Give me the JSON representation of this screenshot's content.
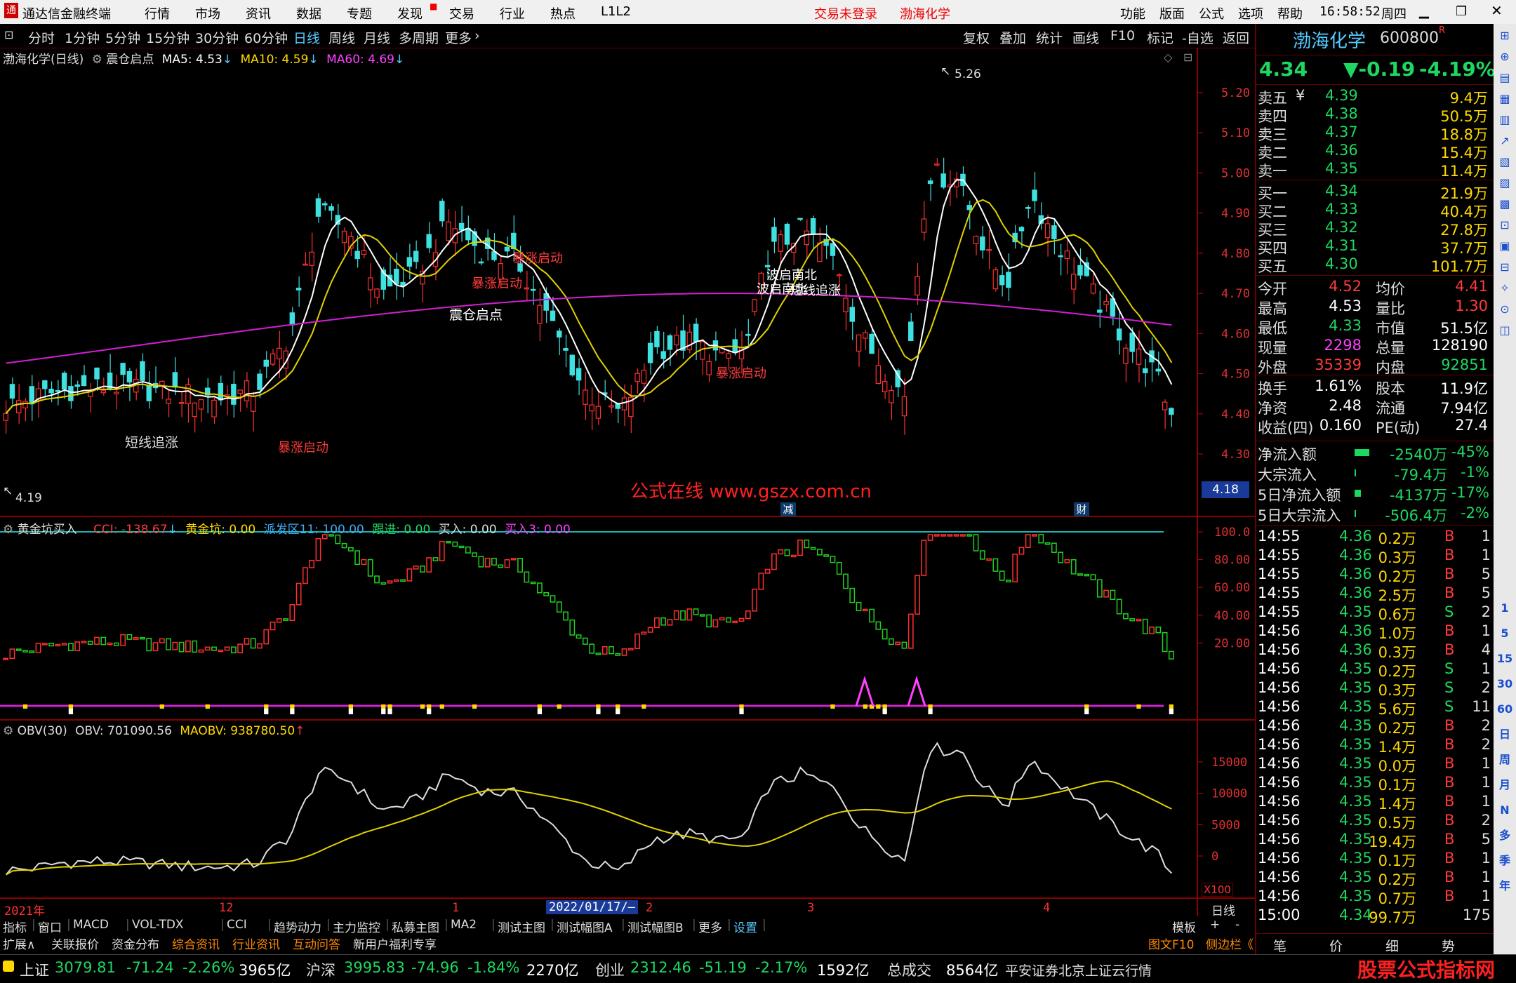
{
  "menubar": {
    "app_title": "通达信金融终端",
    "menus": [
      "行情",
      "市场",
      "资讯",
      "数据",
      "专题",
      "发现",
      "交易",
      "行业",
      "热点",
      "L1L2"
    ],
    "center_status": "交易未登录",
    "center_stock": "渤海化学",
    "right_menus": [
      "功能",
      "版面",
      "公式",
      "选项",
      "帮助"
    ],
    "time": "16:58:52",
    "weekday": "周四"
  },
  "toolbar": {
    "periods": [
      "分时",
      "1分钟",
      "5分钟",
      "15分钟",
      "30分钟",
      "60分钟",
      "日线",
      "周线",
      "月线",
      "多周期",
      "更多"
    ],
    "active": "日线",
    "right_tools": [
      "复权",
      "叠加",
      "统计",
      "画线",
      "F10",
      "标记",
      "-自选",
      "返回"
    ]
  },
  "main_chart": {
    "title": "渤海化学(日线)",
    "formula": "震仓启点",
    "ma5": "MA5: 4.53",
    "ma10": "MA10: 4.59",
    "ma60": "MA60: 4.69",
    "high_mark": "5.26",
    "low_mark": "4.19",
    "cursor_price": "4.18",
    "watermark": "公式在线 www.gszx.com.cn",
    "axis_ticks": [
      "5.20",
      "5.10",
      "5.00",
      "4.90",
      "4.80",
      "4.70",
      "4.60",
      "4.50",
      "4.40",
      "4.30"
    ],
    "annotations": [
      {
        "text": "短线追涨",
        "color": "#ffffff"
      },
      {
        "text": "暴涨启动",
        "color": "#ff3030"
      },
      {
        "text": "震仓启点",
        "color": "#ffffff"
      },
      {
        "text": "暴涨启动",
        "color": "#ff3030"
      },
      {
        "text": "暴涨启动",
        "color": "#ff3030"
      },
      {
        "text": "暴涨启动",
        "color": "#ff3030"
      },
      {
        "text": "波启南北",
        "color": "#ffffff"
      },
      {
        "text": "波启南北",
        "color": "#ffffff"
      },
      {
        "text": "短线追涨",
        "color": "#ffffff"
      }
    ],
    "event_badges": [
      "减",
      "财"
    ]
  },
  "chart_data": {
    "type": "candlestick",
    "title": "渤海化学(日线)",
    "ylim": [
      4.19,
      5.26
    ],
    "series": [
      {
        "name": "MA5",
        "value": 4.53
      },
      {
        "name": "MA10",
        "value": 4.59
      },
      {
        "name": "MA60",
        "value": 4.69
      }
    ],
    "x_labels": [
      "2021年",
      "12",
      "1",
      "2022/01/17/—",
      "2",
      "3",
      "4"
    ]
  },
  "indicator1": {
    "title": "黄金坑买入",
    "cci": "CCI: -138.67",
    "gold": "黄金坑: 0.00",
    "zone": "派发区11: 100.00",
    "follow": "跟进: 0.00",
    "buy": "买入: 0.00",
    "buy3": "买入3: 0.00",
    "axis_ticks": [
      "100.0",
      "80.00",
      "60.00",
      "40.00",
      "20.00"
    ]
  },
  "indicator2": {
    "title": "OBV(30)",
    "obv": "OBV: 701090.56",
    "maobv": "MAOBV: 938780.50",
    "axis_ticks": [
      "15000",
      "10000",
      "5000",
      "0"
    ],
    "scale": "X100"
  },
  "xaxis": {
    "labels": [
      "2021年",
      "12",
      "1",
      "2022/01/17/—",
      "2",
      "3",
      "4"
    ],
    "period": "日线"
  },
  "quote": {
    "name": "渤海化学",
    "code": "600800",
    "flag": "R",
    "price": "4.34",
    "change": "▼-0.19",
    "pct": "-4.19%",
    "asks": [
      {
        "label": "卖五",
        "mark": "¥",
        "price": "4.39",
        "vol": "9.4万"
      },
      {
        "label": "卖四",
        "mark": "",
        "price": "4.38",
        "vol": "50.5万"
      },
      {
        "label": "卖三",
        "mark": "",
        "price": "4.37",
        "vol": "18.8万"
      },
      {
        "label": "卖二",
        "mark": "",
        "price": "4.36",
        "vol": "15.4万"
      },
      {
        "label": "卖一",
        "mark": "",
        "price": "4.35",
        "vol": "11.4万"
      }
    ],
    "bids": [
      {
        "label": "买一",
        "price": "4.34",
        "vol": "21.9万"
      },
      {
        "label": "买二",
        "price": "4.33",
        "vol": "40.4万"
      },
      {
        "label": "买三",
        "price": "4.32",
        "vol": "27.8万"
      },
      {
        "label": "买四",
        "price": "4.31",
        "vol": "37.7万"
      },
      {
        "label": "买五",
        "price": "4.30",
        "vol": "101.7万"
      }
    ],
    "stats": [
      {
        "k1": "今开",
        "v1": "4.52",
        "c1": "#ff3b3b",
        "k2": "均价",
        "v2": "4.41",
        "c2": "#ff3b3b"
      },
      {
        "k1": "最高",
        "v1": "4.53",
        "c1": "#ffffff",
        "k2": "量比",
        "v2": "1.30",
        "c2": "#ff3b3b"
      },
      {
        "k1": "最低",
        "v1": "4.33",
        "c1": "#1ed760",
        "k2": "市值",
        "v2": "51.5亿",
        "c2": "#ffffff"
      },
      {
        "k1": "现量",
        "v1": "2298",
        "c1": "#ff40ff",
        "k2": "总量",
        "v2": "128190",
        "c2": "#ffffff"
      },
      {
        "k1": "外盘",
        "v1": "35339",
        "c1": "#ff3b3b",
        "k2": "内盘",
        "v2": "92851",
        "c2": "#1ed760"
      }
    ],
    "stats2": [
      {
        "k1": "换手",
        "v1": "1.61%",
        "k2": "股本",
        "v2": "11.9亿"
      },
      {
        "k1": "净资",
        "v1": "2.48",
        "k2": "流通",
        "v2": "7.94亿"
      },
      {
        "k1": "收益(四)",
        "v1": "0.160",
        "k2": "PE(动)",
        "v2": "27.4"
      }
    ],
    "flows": [
      {
        "k": "净流入额",
        "v": "-2540万",
        "p": "-45%",
        "bar": 46
      },
      {
        "k": "大宗流入",
        "v": "-79.4万",
        "p": "-1%",
        "bar": 2
      },
      {
        "k": "5日净流入额",
        "v": "-4137万",
        "p": "-17%",
        "bar": 20
      },
      {
        "k": "5日大宗流入",
        "v": "-506.4万",
        "p": "-2%",
        "bar": 2
      }
    ],
    "ticks": [
      {
        "t": "14:55",
        "p": "4.36",
        "v": "0.2万",
        "s": "B",
        "n": "1"
      },
      {
        "t": "14:55",
        "p": "4.36",
        "v": "0.3万",
        "s": "B",
        "n": "1"
      },
      {
        "t": "14:55",
        "p": "4.36",
        "v": "0.2万",
        "s": "B",
        "n": "5"
      },
      {
        "t": "14:55",
        "p": "4.36",
        "v": "2.5万",
        "s": "B",
        "n": "5"
      },
      {
        "t": "14:55",
        "p": "4.35",
        "v": "0.6万",
        "s": "S",
        "n": "2"
      },
      {
        "t": "14:56",
        "p": "4.36",
        "v": "1.0万",
        "s": "B",
        "n": "1"
      },
      {
        "t": "14:56",
        "p": "4.36",
        "v": "0.3万",
        "s": "B",
        "n": "4"
      },
      {
        "t": "14:56",
        "p": "4.35",
        "v": "0.2万",
        "s": "S",
        "n": "1"
      },
      {
        "t": "14:56",
        "p": "4.35",
        "v": "0.3万",
        "s": "S",
        "n": "2"
      },
      {
        "t": "14:56",
        "p": "4.35",
        "v": "5.6万",
        "s": "S",
        "n": "11"
      },
      {
        "t": "14:56",
        "p": "4.35",
        "v": "0.2万",
        "s": "B",
        "n": "2"
      },
      {
        "t": "14:56",
        "p": "4.35",
        "v": "1.4万",
        "s": "B",
        "n": "2"
      },
      {
        "t": "14:56",
        "p": "4.35",
        "v": "0.0万",
        "s": "B",
        "n": "1"
      },
      {
        "t": "14:56",
        "p": "4.35",
        "v": "0.1万",
        "s": "B",
        "n": "1"
      },
      {
        "t": "14:56",
        "p": "4.35",
        "v": "1.4万",
        "s": "B",
        "n": "1"
      },
      {
        "t": "14:56",
        "p": "4.35",
        "v": "0.5万",
        "s": "B",
        "n": "2"
      },
      {
        "t": "14:56",
        "p": "4.35",
        "v": "19.4万",
        "s": "B",
        "n": "5"
      },
      {
        "t": "14:56",
        "p": "4.35",
        "v": "0.1万",
        "s": "B",
        "n": "1"
      },
      {
        "t": "14:56",
        "p": "4.35",
        "v": "0.2万",
        "s": "B",
        "n": "1"
      },
      {
        "t": "14:56",
        "p": "4.35",
        "v": "0.7万",
        "s": "B",
        "n": "1"
      },
      {
        "t": "15:00",
        "p": "4.34",
        "v": "99.7万",
        "s": "",
        "n": "175"
      }
    ],
    "bottom_tabs": [
      "笔",
      "价",
      "细",
      "势"
    ]
  },
  "side_icons": [
    "1",
    "5",
    "15",
    "30",
    "60",
    "日",
    "周",
    "月",
    "N",
    "多",
    "季",
    "年"
  ],
  "tabs_row1": [
    "指标",
    "窗口",
    "MACD",
    "VOL-TDX",
    "CCI",
    "趋势动力",
    "主力监控",
    "私募主图",
    "MA2",
    "测试主图",
    "测试幅图A",
    "测试幅图B",
    "更多",
    "设置"
  ],
  "tabs_row1_right": [
    "模板",
    "+",
    "-"
  ],
  "tabs_row2": [
    "扩展∧",
    "关联报价",
    "资金分布",
    "综合资讯",
    "行业资讯",
    "互动问答",
    "新用户福利专享"
  ],
  "tabs_row2_right": [
    "图文F10",
    "侧边栏《"
  ],
  "status": {
    "sh_label": "上证",
    "sh": "3079.81",
    "sh_chg": "-71.24",
    "sh_pct": "-2.26%",
    "sh_amt": "3965亿",
    "hs_label": "沪深",
    "hs": "3995.83",
    "hs_chg": "-74.96",
    "hs_pct": "-1.84%",
    "hs_amt": "2270亿",
    "cy_label": "创业",
    "cy": "2312.46",
    "cy_chg": "-51.19",
    "cy_pct": "-2.17%",
    "cy_amt": "1592亿",
    "total_label": "总成交",
    "total": "8564亿",
    "broker": "平安证券北京上证云行情",
    "logo": "股票公式指标网",
    "logo_url": "www.gszx.com"
  }
}
